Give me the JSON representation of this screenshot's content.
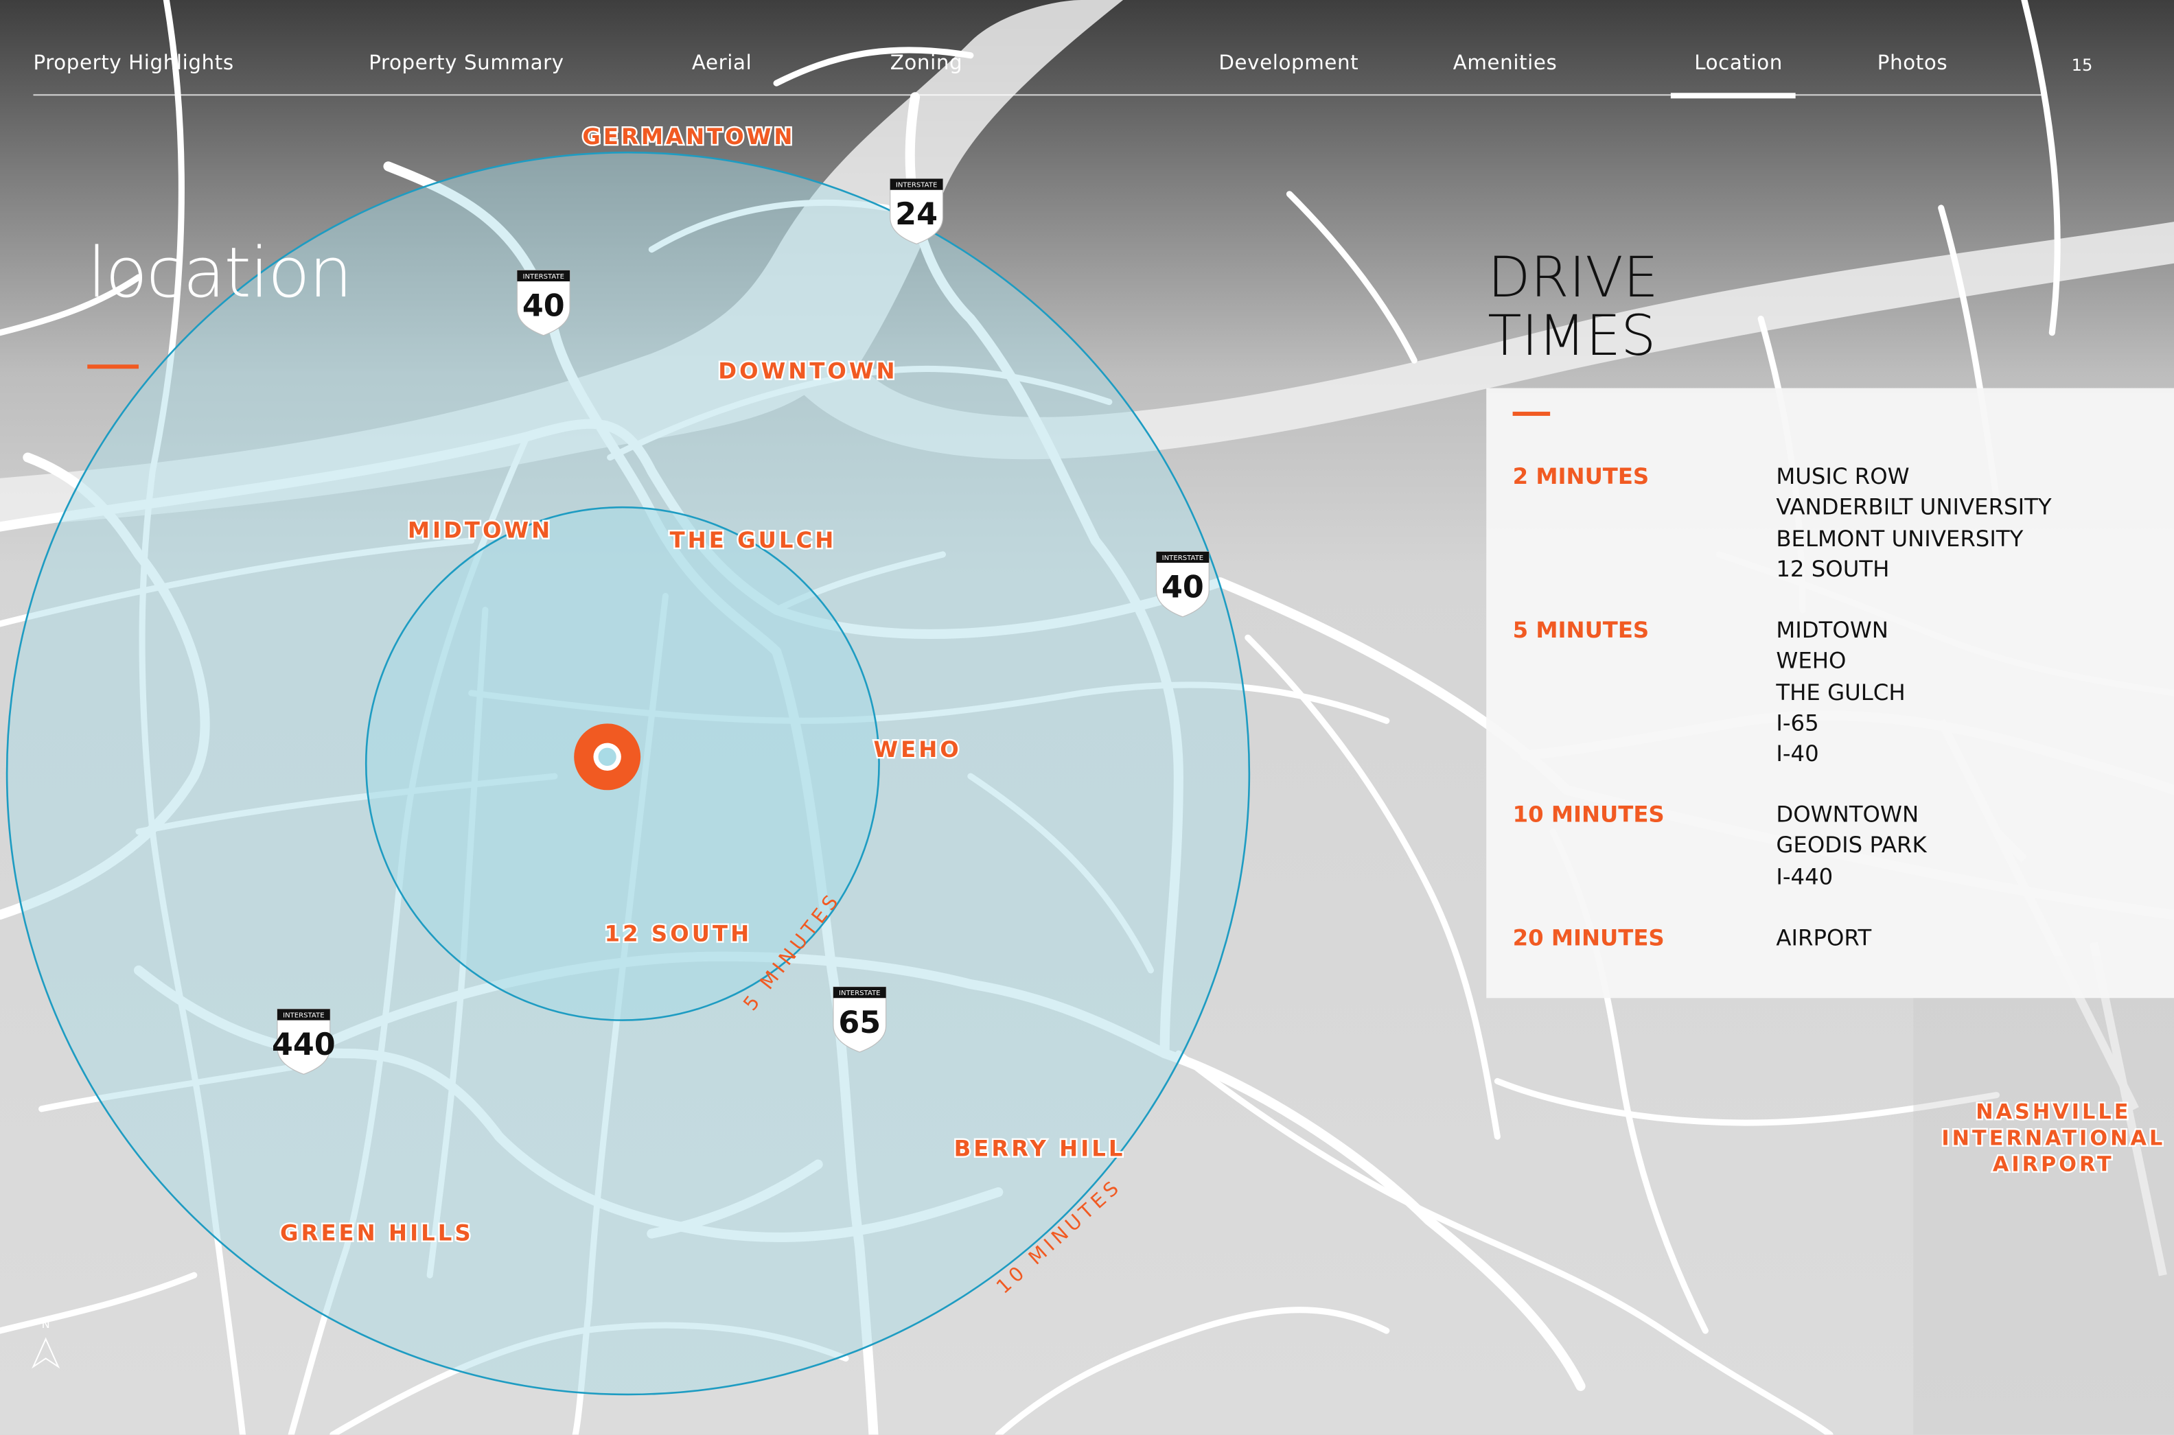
{
  "nav": {
    "items": [
      {
        "label": "Property Highlights"
      },
      {
        "label": "Property Summary"
      },
      {
        "label": "Aerial"
      },
      {
        "label": "Zoning"
      },
      {
        "label": "Development"
      },
      {
        "label": "Amenities"
      },
      {
        "label": "Location"
      },
      {
        "label": "Photos"
      }
    ],
    "active": "Location",
    "page_number": "15"
  },
  "page_title": "location",
  "map": {
    "neighborhoods": [
      "GERMANTOWN",
      "DOWNTOWN",
      "MIDTOWN",
      "THE GULCH",
      "WEHO",
      "12 SOUTH",
      "BERRY HILL",
      "GREEN HILLS"
    ],
    "airport_label": [
      "NASHVILLE",
      "INTERNATIONAL",
      "AIRPORT"
    ],
    "ring_labels": [
      "5 MINUTES",
      "10 MINUTES"
    ],
    "shields": [
      {
        "top": "INTERSTATE",
        "number": "24"
      },
      {
        "top": "INTERSTATE",
        "number": "40"
      },
      {
        "top": "INTERSTATE",
        "number": "40"
      },
      {
        "top": "INTERSTATE",
        "number": "440"
      },
      {
        "top": "INTERSTATE",
        "number": "65"
      }
    ],
    "compass": "N",
    "colors": {
      "accent": "#f15a22",
      "ring_fill": "#a9dbe6",
      "ring_stroke": "#1e9cc2",
      "road": "#ffffff",
      "river": "#f0f0f0"
    }
  },
  "drive_times": {
    "title_line1": "DRIVE",
    "title_line2": "TIMES",
    "groups": [
      {
        "minutes": "2 MINUTES",
        "places": [
          "MUSIC ROW",
          "VANDERBILT UNIVERSITY",
          "BELMONT UNIVERSITY",
          "12 SOUTH"
        ]
      },
      {
        "minutes": "5 MINUTES",
        "places": [
          "MIDTOWN",
          "WEHO",
          "THE GULCH",
          "I-65",
          "I-40"
        ]
      },
      {
        "minutes": "10 MINUTES",
        "places": [
          "DOWNTOWN",
          "GEODIS PARK",
          "I-440"
        ]
      },
      {
        "minutes": "20 MINUTES",
        "places": [
          "AIRPORT"
        ]
      }
    ]
  }
}
